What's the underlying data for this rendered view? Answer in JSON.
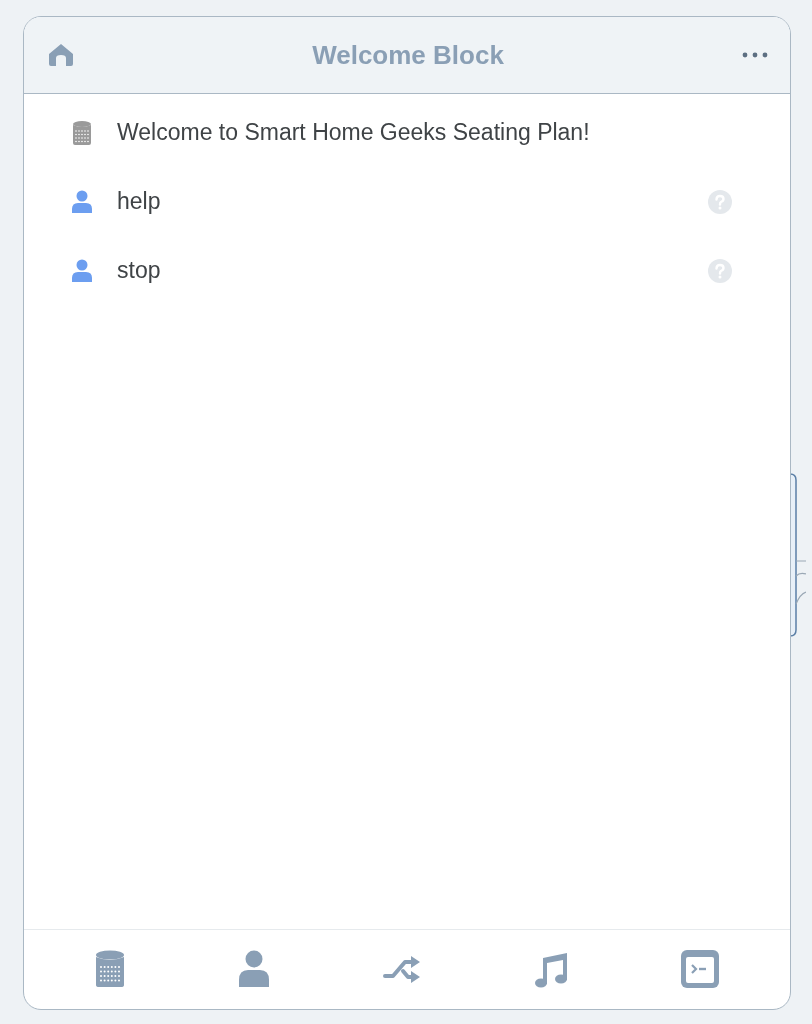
{
  "header": {
    "title": "Welcome Block"
  },
  "messages": [
    {
      "kind": "speaker",
      "text": "Welcome to Smart Home Geeks Seating Plan!",
      "help": false
    },
    {
      "kind": "user",
      "text": "help",
      "help": true
    },
    {
      "kind": "user",
      "text": "stop",
      "help": true
    }
  ]
}
